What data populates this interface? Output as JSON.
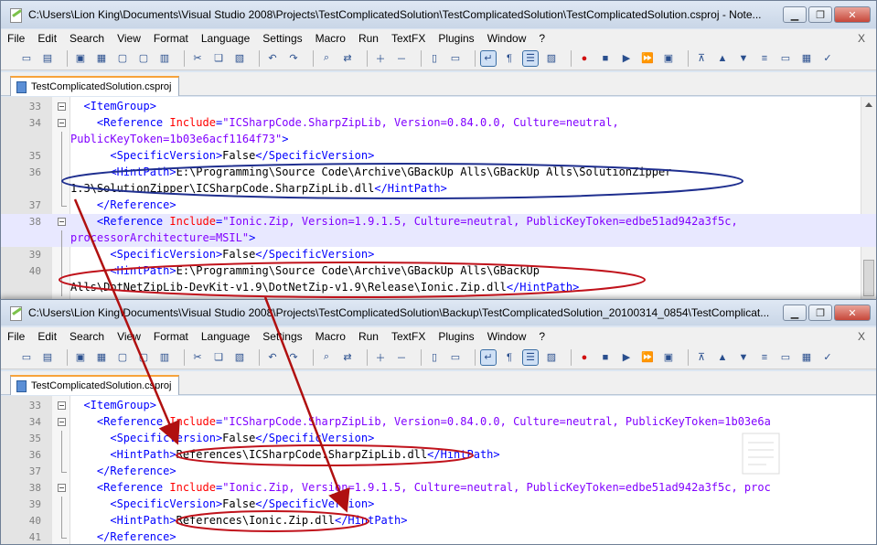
{
  "window1": {
    "title": "C:\\Users\\Lion King\\Documents\\Visual Studio 2008\\Projects\\TestComplicatedSolution\\TestComplicatedSolution\\TestComplicatedSolution.csproj - Note...",
    "menu": [
      "File",
      "Edit",
      "Search",
      "View",
      "Format",
      "Language",
      "Settings",
      "Macro",
      "Run",
      "TextFX",
      "Plugins",
      "Window",
      "?"
    ],
    "menu_close": "X",
    "tab": "TestComplicatedSolution.csproj",
    "lines": [
      {
        "n": "33",
        "fold": "minus",
        "segs": [
          [
            "t",
            "  <ItemGroup>"
          ]
        ]
      },
      {
        "n": "34",
        "fold": "minus",
        "segs": [
          [
            "t",
            "    <Reference "
          ],
          [
            "a",
            "Include"
          ],
          [
            "t",
            "="
          ],
          [
            "v",
            "\"ICSharpCode.SharpZipLib, Version=0.84.0.0, Culture=neutral,"
          ]
        ]
      },
      {
        "n": "",
        "fold": "line",
        "segs": [
          [
            "v",
            "PublicKeyToken=1b03e6acf1164f73\""
          ],
          [
            "t",
            ">"
          ]
        ]
      },
      {
        "n": "35",
        "fold": "line",
        "segs": [
          [
            "t",
            "      <SpecificVersion>"
          ],
          [
            "x",
            "False"
          ],
          [
            "t",
            "</SpecificVersion>"
          ]
        ]
      },
      {
        "n": "36",
        "fold": "line",
        "segs": [
          [
            "t",
            "      <HintPath>"
          ],
          [
            "x",
            "E:\\Programming\\Source Code\\Archive\\GBackUp Alls\\GBackUp Alls\\SolutionZipper"
          ]
        ]
      },
      {
        "n": "",
        "fold": "line",
        "segs": [
          [
            "x",
            "1.3\\SolutionZipper\\ICSharpCode.SharpZipLib.dll"
          ],
          [
            "t",
            "</HintPath>"
          ]
        ]
      },
      {
        "n": "37",
        "fold": "end",
        "segs": [
          [
            "t",
            "    </Reference>"
          ]
        ]
      },
      {
        "n": "38",
        "fold": "minus",
        "hl": true,
        "segs": [
          [
            "t",
            "    <Reference "
          ],
          [
            "a",
            "Include"
          ],
          [
            "t",
            "="
          ],
          [
            "v",
            "\"Ionic.Zip, Version=1.9.1.5, Culture=neutral, PublicKeyToken=edbe51ad942a3f5c,"
          ]
        ]
      },
      {
        "n": "",
        "fold": "line",
        "hl": true,
        "segs": [
          [
            "v",
            "processorArchitecture=MSIL\""
          ],
          [
            "t",
            ">"
          ]
        ]
      },
      {
        "n": "39",
        "fold": "line",
        "segs": [
          [
            "t",
            "      <SpecificVersion>"
          ],
          [
            "x",
            "False"
          ],
          [
            "t",
            "</SpecificVersion>"
          ]
        ]
      },
      {
        "n": "40",
        "fold": "line",
        "segs": [
          [
            "t",
            "      <HintPath>"
          ],
          [
            "x",
            "E:\\Programming\\Source Code\\Archive\\GBackUp Alls\\GBackUp"
          ]
        ]
      },
      {
        "n": "",
        "fold": "line",
        "segs": [
          [
            "x",
            "Alls\\DotNetZipLib-DevKit-v1.9\\DotNetZip-v1.9\\Release\\Ionic.Zip.dll"
          ],
          [
            "t",
            "</HintPath>"
          ]
        ]
      }
    ]
  },
  "window2": {
    "title": "C:\\Users\\Lion King\\Documents\\Visual Studio 2008\\Projects\\TestComplicatedSolution\\Backup\\TestComplicatedSolution_20100314_0854\\TestComplicat...",
    "menu": [
      "File",
      "Edit",
      "Search",
      "View",
      "Format",
      "Language",
      "Settings",
      "Macro",
      "Run",
      "TextFX",
      "Plugins",
      "Window",
      "?"
    ],
    "menu_close": "X",
    "tab": "TestComplicatedSolution.csproj",
    "lines": [
      {
        "n": "33",
        "fold": "minus",
        "segs": [
          [
            "t",
            "  <ItemGroup>"
          ]
        ]
      },
      {
        "n": "34",
        "fold": "minus",
        "segs": [
          [
            "t",
            "    <Reference "
          ],
          [
            "a",
            "Include"
          ],
          [
            "t",
            "="
          ],
          [
            "v",
            "\"ICSharpCode.SharpZipLib, Version=0.84.0.0, Culture=neutral, PublicKeyToken=1b03e6a"
          ]
        ]
      },
      {
        "n": "35",
        "fold": "line",
        "segs": [
          [
            "t",
            "      <SpecificVersion>"
          ],
          [
            "x",
            "False"
          ],
          [
            "t",
            "</SpecificVersion>"
          ]
        ]
      },
      {
        "n": "36",
        "fold": "line",
        "segs": [
          [
            "t",
            "      <HintPath>"
          ],
          [
            "x",
            "References\\ICSharpCode.SharpZipLib.dll"
          ],
          [
            "t",
            "</HintPath>"
          ]
        ]
      },
      {
        "n": "37",
        "fold": "end",
        "segs": [
          [
            "t",
            "    </Reference>"
          ]
        ]
      },
      {
        "n": "38",
        "fold": "minus",
        "segs": [
          [
            "t",
            "    <Reference "
          ],
          [
            "a",
            "Include"
          ],
          [
            "t",
            "="
          ],
          [
            "v",
            "\"Ionic.Zip, Version=1.9.1.5, Culture=neutral, PublicKeyToken=edbe51ad942a3f5c, proc"
          ]
        ]
      },
      {
        "n": "39",
        "fold": "line",
        "segs": [
          [
            "t",
            "      <SpecificVersion>"
          ],
          [
            "x",
            "False"
          ],
          [
            "t",
            "</SpecificVersion>"
          ]
        ]
      },
      {
        "n": "40",
        "fold": "line",
        "segs": [
          [
            "t",
            "      <HintPath>"
          ],
          [
            "x",
            "References\\Ionic.Zip.dll"
          ],
          [
            "t",
            "</HintPath>"
          ]
        ]
      },
      {
        "n": "41",
        "fold": "end",
        "segs": [
          [
            "t",
            "    </Reference>"
          ]
        ]
      }
    ]
  },
  "colors": {
    "tag": "#0000ff",
    "attr": "#ff0000",
    "value": "#8000ff",
    "text": "#000000",
    "annotation_blue": "#1f2f8f",
    "annotation_red": "#c0121b",
    "arrow": "#b01010"
  },
  "toolbar_icons": [
    "new-icon",
    "open-icon",
    "save-icon",
    "save-all-icon",
    "close-icon",
    "close-all-icon",
    "print-icon",
    "cut-icon",
    "copy-icon",
    "paste-icon",
    "undo-icon",
    "redo-icon",
    "find-icon",
    "replace-icon",
    "zoom-in-icon",
    "zoom-out-icon",
    "sync-v-icon",
    "sync-h-icon",
    "wrap-icon",
    "show-all-chars-icon",
    "indent-guide-icon",
    "user-lang-icon",
    "record-icon",
    "stop-icon",
    "play-icon",
    "play-multi-icon",
    "save-macro-icon",
    "collapse-icon",
    "up-icon",
    "down-icon",
    "unfold-icon",
    "console-icon",
    "doc-map-icon",
    "spellcheck-icon"
  ]
}
